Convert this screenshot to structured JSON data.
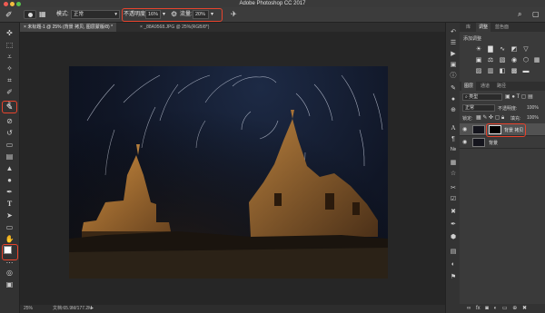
{
  "window": {
    "title": "Adobe Photoshop CC 2017"
  },
  "options_bar": {
    "mode_label": "模式:",
    "mode_value": "正常",
    "opacity_label": "不透明度:",
    "opacity_value": "16%",
    "flow_label": "流量:",
    "flow_value": "20%"
  },
  "doc_tabs": [
    {
      "label": "未标题-1 @ 25% (背景 拷贝, 图层蒙版/8) *",
      "active": true
    },
    {
      "label": "_88A9568.JPG @ 25%(RGB/8*)",
      "active": false
    }
  ],
  "status_bar": {
    "zoom": "25%",
    "doc_size": "文档:65.9M/177.2M"
  },
  "panels": {
    "top_tabs": [
      "库",
      "调整",
      "蓝色面"
    ],
    "adjustments_title": "添加调整",
    "layer_tabs": [
      "图层",
      "通道",
      "路径"
    ],
    "kind_filter": "类型",
    "blend_mode": "正常",
    "opacity_label": "不透明度:",
    "opacity_value": "100%",
    "lock_label": "锁定:",
    "fill_label": "填充:",
    "fill_value": "100%",
    "layers": [
      {
        "name": "背景 拷贝",
        "has_mask": true,
        "selected": true
      },
      {
        "name": "背景",
        "has_mask": false,
        "selected": false
      }
    ]
  },
  "colors": {
    "highlight": "#e8442d",
    "foreground": "#ffffff",
    "background": "#000000"
  }
}
